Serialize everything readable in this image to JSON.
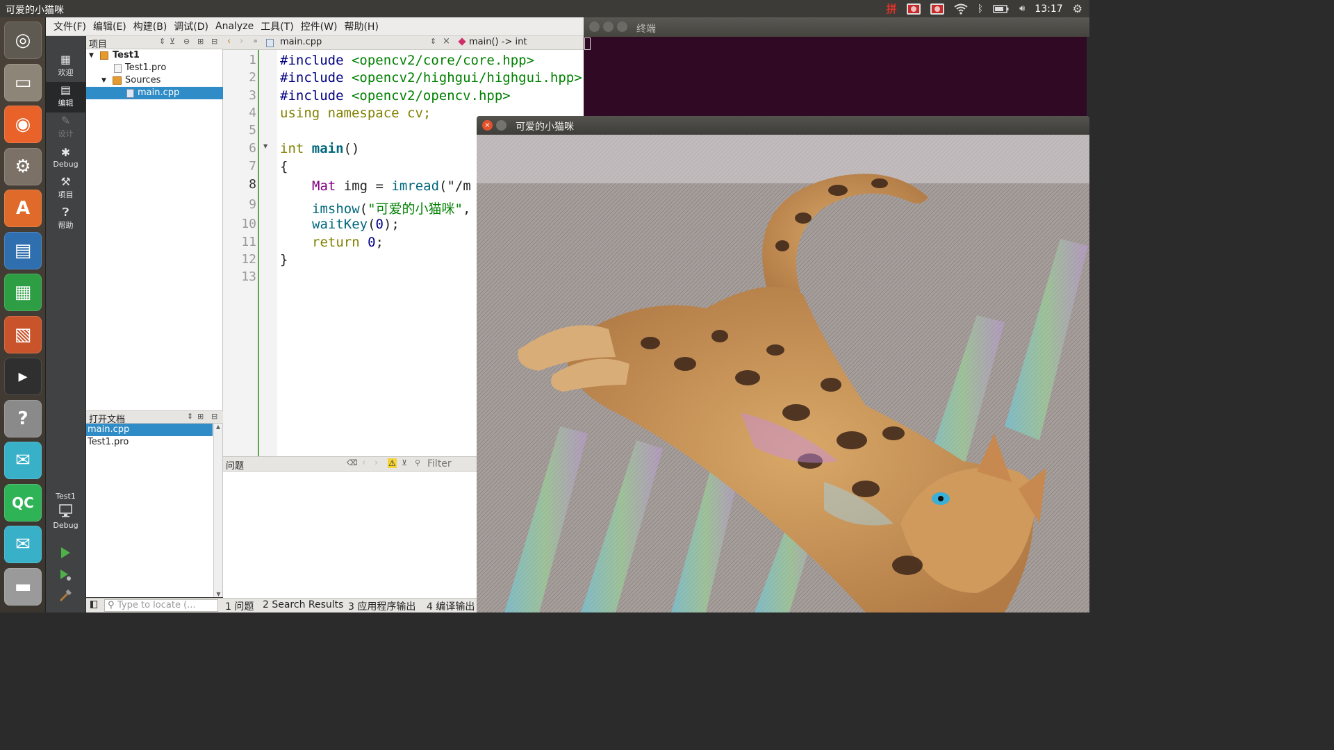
{
  "top_panel": {
    "window_title": "可爱的小猫咪",
    "ime_label": "拼",
    "time": "13:17"
  },
  "menubar": [
    "文件(F)",
    "编辑(E)",
    "构建(B)",
    "调试(D)",
    "Analyze",
    "工具(T)",
    "控件(W)",
    "帮助(H)"
  ],
  "modes": [
    {
      "label": "欢迎",
      "icon": "grid-icon",
      "state": "normal"
    },
    {
      "label": "编辑",
      "icon": "edit-icon",
      "state": "active"
    },
    {
      "label": "设计",
      "icon": "pencil-icon",
      "state": "disabled"
    },
    {
      "label": "Debug",
      "icon": "bug-icon",
      "state": "normal"
    },
    {
      "label": "项目",
      "icon": "wrench-icon",
      "state": "normal"
    },
    {
      "label": "帮助",
      "icon": "help-icon",
      "state": "normal"
    }
  ],
  "kit": {
    "project": "Test1",
    "config": "Debug"
  },
  "project_pane": {
    "title": "项目",
    "tree": [
      {
        "label": "Test1",
        "level": 0,
        "expanded": true,
        "bold": true
      },
      {
        "label": "Test1.pro",
        "level": 1
      },
      {
        "label": "Sources",
        "level": 1,
        "expanded": true
      },
      {
        "label": "main.cpp",
        "level": 2,
        "selected": true
      }
    ]
  },
  "open_docs": {
    "title": "打开文档",
    "items": [
      {
        "label": "main.cpp",
        "selected": true
      },
      {
        "label": "Test1.pro"
      }
    ]
  },
  "editor": {
    "file": "main.cpp",
    "symbol": "main() -> int",
    "line_numbers": [
      "1",
      "2",
      "3",
      "4",
      "5",
      "6",
      "7",
      "8",
      "9",
      "10",
      "11",
      "12",
      "13"
    ],
    "current_line": "8"
  },
  "code": {
    "l1a": "#include",
    "l1b": " <opencv2/core/core.hpp>",
    "l2a": "#include",
    "l2b": " <opencv2/highgui/highgui.hpp>",
    "l3a": "#include",
    "l3b": " <opencv2/opencv.hpp>",
    "l4": "using namespace cv;",
    "l6a": "int",
    "l6b": "main",
    "l6c": "()",
    "l7": "{",
    "l8a": "Mat",
    "l8b": " img = ",
    "l8c": "imread",
    "l8d": "(\"/m",
    "l9a": "imshow",
    "l9b": "(",
    "l9c": "\"可爱的小猫咪\"",
    "l9d": ",",
    "l10a": "waitKey",
    "l10b": "(",
    "l10c": "0",
    "l10d": ");",
    "l11a": "return",
    "l11b": " 0",
    "l11c": ";",
    "l12": "}"
  },
  "issues": {
    "title": "问题",
    "filter_placeholder": "Filter"
  },
  "statusbar": {
    "locate_placeholder": "Type to locate (...",
    "tabs": [
      "1 问题",
      "2 Search Results",
      "3 应用程序输出",
      "4 编译输出"
    ]
  },
  "terminal": {
    "title": "终端"
  },
  "image_window": {
    "title": "可爱的小猫咪"
  },
  "launcher": [
    {
      "name": "ubuntu-logo-icon",
      "color": "#5e5a52"
    },
    {
      "name": "files-icon",
      "color": "#8d8578"
    },
    {
      "name": "firefox-icon",
      "color": "#e8622a"
    },
    {
      "name": "settings-icon",
      "color": "#7c7166"
    },
    {
      "name": "software-center-icon",
      "color": "#e06a2a"
    },
    {
      "name": "writer-icon",
      "color": "#2f6fb0"
    },
    {
      "name": "calc-icon",
      "color": "#2e9e44"
    },
    {
      "name": "impress-icon",
      "color": "#c9542b"
    },
    {
      "name": "terminal-icon",
      "color": "#2f2f2f"
    },
    {
      "name": "help-icon",
      "color": "#8a8a8a"
    },
    {
      "name": "wechat-icon",
      "color": "#38b0c8"
    },
    {
      "name": "qtcreator-icon",
      "color": "#2fb357"
    },
    {
      "name": "wechat-icon-2",
      "color": "#38b0c8"
    },
    {
      "name": "disk-icon",
      "color": "#9a9a9a"
    }
  ]
}
